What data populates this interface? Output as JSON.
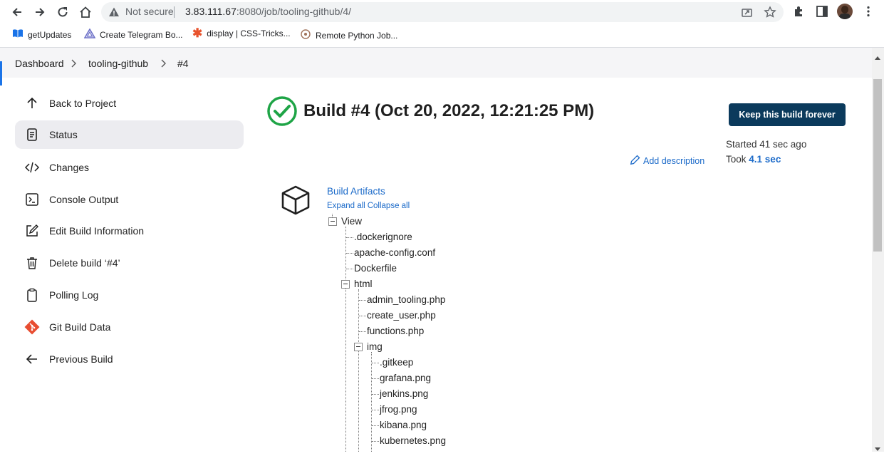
{
  "browser": {
    "not_secure": "Not secure",
    "url_host": "3.83.111.67",
    "url_path": ":8080/job/tooling-github/4/",
    "bookmarks": [
      {
        "label": "getUpdates",
        "icon": "book-icon"
      },
      {
        "label": "Create Telegram Bo...",
        "icon": "triangle-logo-icon"
      },
      {
        "label": "display | CSS-Tricks...",
        "icon": "asterisk-icon"
      },
      {
        "label": "Remote Python Job...",
        "icon": "globe-icon"
      }
    ]
  },
  "breadcrumb": [
    "Dashboard",
    "tooling-github",
    "#4"
  ],
  "sidebar": {
    "items": [
      {
        "label": "Back to Project",
        "icon": "arrow-up-icon"
      },
      {
        "label": "Status",
        "icon": "document-icon",
        "active": true
      },
      {
        "label": "Changes",
        "icon": "code-icon"
      },
      {
        "label": "Console Output",
        "icon": "terminal-icon"
      },
      {
        "label": "Edit Build Information",
        "icon": "edit-icon"
      },
      {
        "label": "Delete build ‘#4’",
        "icon": "trash-icon"
      },
      {
        "label": "Polling Log",
        "icon": "clipboard-icon"
      },
      {
        "label": "Git Build Data",
        "icon": "git-icon"
      },
      {
        "label": "Previous Build",
        "icon": "arrow-left-icon"
      }
    ]
  },
  "main": {
    "title": "Build #4 (Oct 20, 2022, 12:21:25 PM)",
    "keep_button": "Keep this build forever",
    "started": "Started 41 sec ago",
    "took_prefix": "Took ",
    "took_value": "4.1 sec",
    "add_description": "Add description",
    "artifacts": {
      "title": "Build Artifacts",
      "expand_all": "Expand all",
      "collapse_all": "Collapse all",
      "tree": [
        {
          "label": "View",
          "depth": 0,
          "folder": true
        },
        {
          "label": ".dockerignore",
          "depth": 1
        },
        {
          "label": "apache-config.conf",
          "depth": 1
        },
        {
          "label": "Dockerfile",
          "depth": 1
        },
        {
          "label": "html",
          "depth": 1,
          "folder": true
        },
        {
          "label": "admin_tooling.php",
          "depth": 2
        },
        {
          "label": "create_user.php",
          "depth": 2
        },
        {
          "label": "functions.php",
          "depth": 2
        },
        {
          "label": "img",
          "depth": 2,
          "folder": true
        },
        {
          "label": ".gitkeep",
          "depth": 3
        },
        {
          "label": "grafana.png",
          "depth": 3
        },
        {
          "label": "jenkins.png",
          "depth": 3
        },
        {
          "label": "jfrog.png",
          "depth": 3
        },
        {
          "label": "kibana.png",
          "depth": 3
        },
        {
          "label": "kubernetes.png",
          "depth": 3
        }
      ]
    }
  },
  "colors": {
    "accent": "#1b6ac9",
    "button": "#0b3a5c",
    "success": "#1ea446"
  }
}
